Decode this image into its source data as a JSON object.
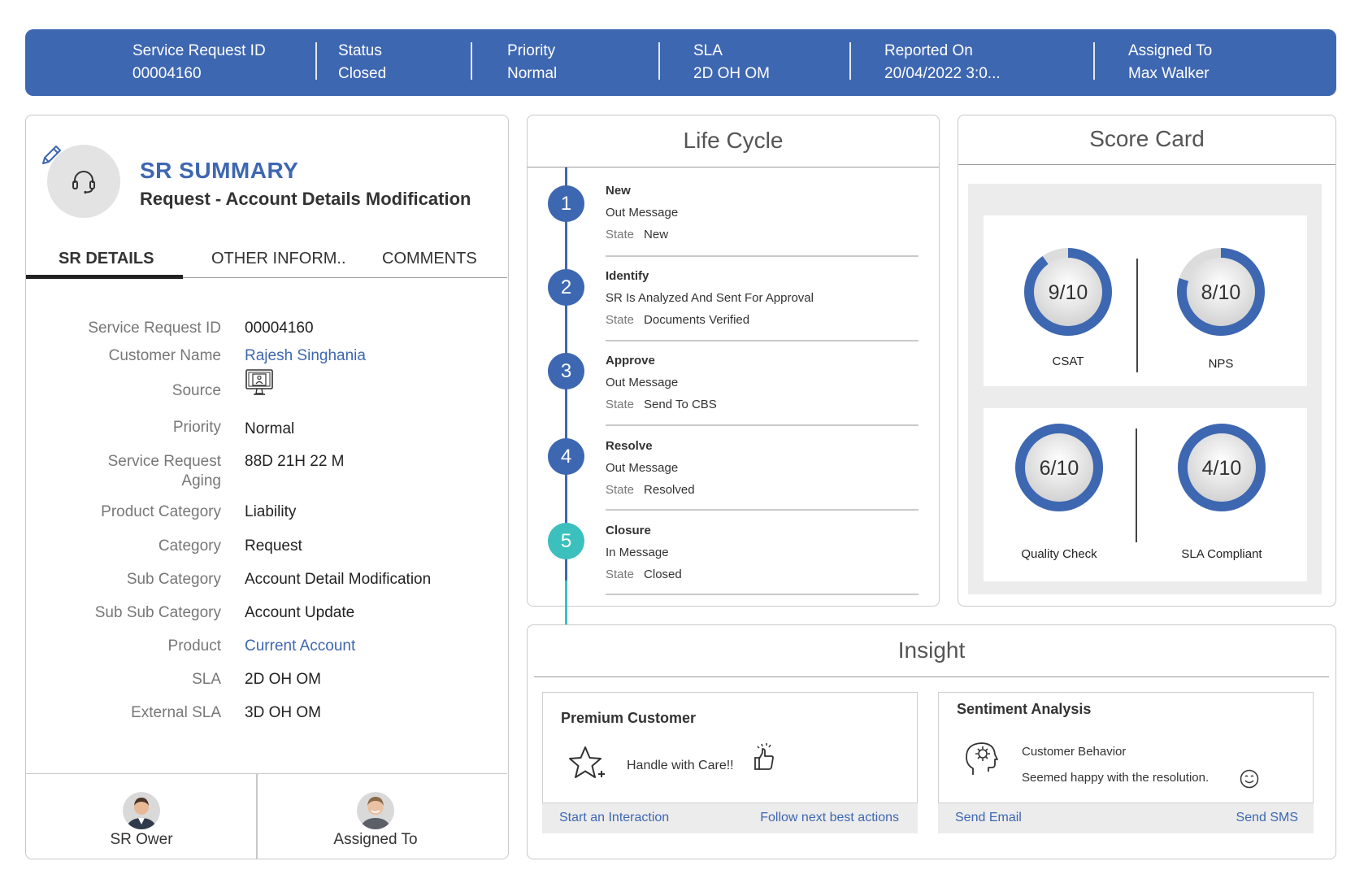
{
  "header": {
    "fields": [
      {
        "label": "Service Request ID",
        "value": "00004160"
      },
      {
        "label": "Status",
        "value": "Closed"
      },
      {
        "label": "Priority",
        "value": "Normal"
      },
      {
        "label": "SLA",
        "value": "2D OH OM"
      },
      {
        "label": "Reported On",
        "value": "20/04/2022 3:0..."
      },
      {
        "label": "Assigned To",
        "value": "Max Walker"
      }
    ]
  },
  "summary": {
    "title": "SR SUMMARY",
    "subtitle": "Request - Account Details Modification",
    "tabs": [
      "SR DETAILS",
      "OTHER INFORM..",
      "COMMENTS"
    ],
    "details": [
      {
        "label": "Service Request ID",
        "value": "00004160"
      },
      {
        "label": "Customer Name",
        "value": "Rajesh Singhania"
      },
      {
        "label": "Source",
        "value": "",
        "icon": "web-portal-icon"
      },
      {
        "label": "Priority",
        "value": "Normal"
      },
      {
        "label": "Service Request Aging",
        "value": "88D 21H 22 M"
      },
      {
        "label": "Product Category",
        "value": "Liability"
      },
      {
        "label": "Category",
        "value": "Request"
      },
      {
        "label": "Sub Category",
        "value": "Account Detail Modification"
      },
      {
        "label": "Sub Sub Category",
        "value": "Account Update"
      },
      {
        "label": "Product",
        "value": "Current Account"
      },
      {
        "label": "SLA",
        "value": "2D OH OM"
      },
      {
        "label": "External SLA",
        "value": "3D OH OM"
      }
    ],
    "people": [
      {
        "label": "SR Ower"
      },
      {
        "label": "Assigned To"
      }
    ]
  },
  "lifecycle": {
    "title": "Life Cycle",
    "state_label": "State",
    "steps": [
      {
        "num": "1",
        "title": "New",
        "message": "Out Message",
        "state": "New"
      },
      {
        "num": "2",
        "title": "Identify",
        "message": "SR Is Analyzed And Sent For Approval",
        "state": "Documents Verified"
      },
      {
        "num": "3",
        "title": "Approve",
        "message": "Out Message",
        "state": "Send To CBS"
      },
      {
        "num": "4",
        "title": "Resolve",
        "message": "Out Message",
        "state": "Resolved"
      },
      {
        "num": "5",
        "title": "Closure",
        "message": "In Message",
        "state": "Closed"
      }
    ]
  },
  "scorecard": {
    "title": "Score Card",
    "scores": [
      {
        "label": "CSAT",
        "text": "9/10",
        "value": 9,
        "max": 10
      },
      {
        "label": "NPS",
        "text": "8/10",
        "value": 8,
        "max": 10
      },
      {
        "label": "Quality Check",
        "text": "6/10",
        "value": 10,
        "max": 10
      },
      {
        "label": "SLA Compliant",
        "text": "4/10",
        "value": 10,
        "max": 10
      }
    ],
    "colors": {
      "ring": "#3e67b1",
      "track": "#dcdcdc"
    }
  },
  "insight": {
    "title": "Insight",
    "premium": {
      "title": "Premium Customer",
      "text": "Handle with Care!!",
      "action_left": "Start an Interaction",
      "action_right": "Follow next best actions"
    },
    "sentiment": {
      "title": "Sentiment Analysis",
      "heading": "Customer Behavior",
      "text": "Seemed happy with the resolution.",
      "action_left": "Send Email",
      "action_right": "Send SMS"
    }
  },
  "colors": {
    "brand": "#3e67b1",
    "teal": "#3cc0be"
  }
}
